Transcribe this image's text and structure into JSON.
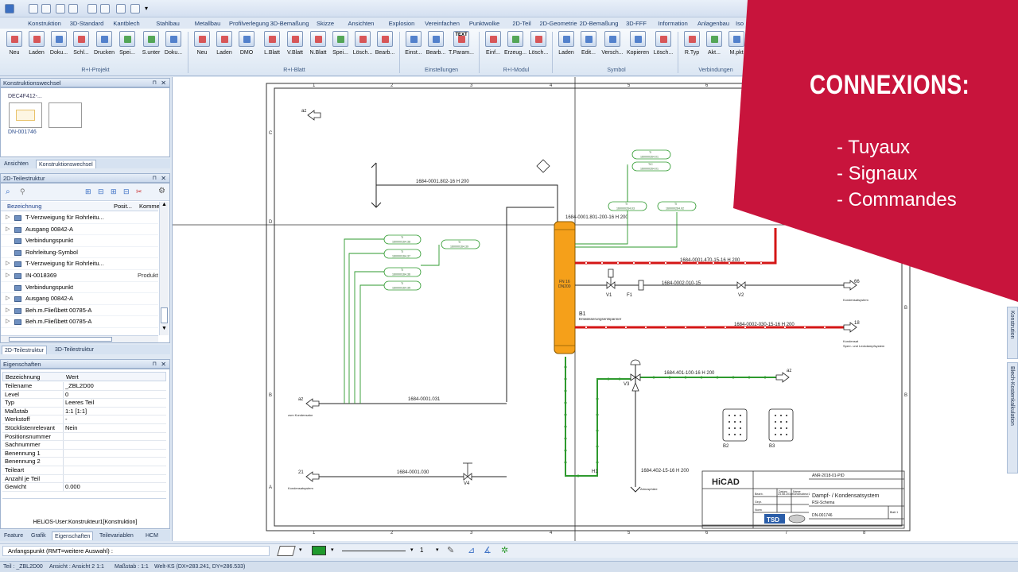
{
  "ribbon": {
    "tabs": [
      "Konstruktion",
      "3D-Standard",
      "Kantblech",
      "Stahlbau",
      "Metallbau",
      "Profilverlegung",
      "3D-Bemaßung",
      "Skizze",
      "Ansichten",
      "Explosion",
      "Vereinfachen",
      "Punktwolke",
      "2D-Teil",
      "2D-Geometrie",
      "2D-Bemaßung",
      "3D-FFF",
      "Information",
      "Anlagenbau",
      "Iso"
    ],
    "buttons": [
      "Neu",
      "Laden",
      "Doku...",
      "Schl...",
      "Drucken",
      "Spei...",
      "S.unter",
      "Doku...",
      "Neu",
      "Laden",
      "DMO",
      "L.Blatt",
      "V.Blatt",
      "N.Blatt",
      "Spei...",
      "Lösch...",
      "Bearb...",
      "Einst...",
      "Bearb...",
      "T.Param...",
      "Einf...",
      "Erzeug...",
      "Lösch...",
      "Laden",
      "Edit...",
      "Versch...",
      "Kopieren",
      "Lösch...",
      "R.Typ",
      "Akt...",
      "M.pkt"
    ],
    "text_icon_label": "TEXT",
    "groups": [
      "R+I-Projekt",
      "R+I-Blatt",
      "Einstellungen",
      "R+I-Modul",
      "Symbol",
      "Verbindungen"
    ]
  },
  "konstruktionswechsel": {
    "title": "Konstruktionswechsel",
    "thumb_label_top": "DEC4F412-...",
    "thumb_label_bottom": "DN-001746",
    "tabs": [
      "Ansichten",
      "Konstruktionswechsel"
    ]
  },
  "teilestruktur": {
    "title": "2D-Teilestruktur",
    "columns": [
      "Bezeichnung",
      "Posit...",
      "Komme..."
    ],
    "rows": [
      {
        "label": "T-Verzweigung für Rohrleitu...",
        "col2": ""
      },
      {
        "label": "Ausgang 00842-A",
        "col2": ""
      },
      {
        "label": "Verbindungspunkt",
        "col2": ""
      },
      {
        "label": "Rohrleitung-Symbol",
        "col2": ""
      },
      {
        "label": "T-Verzweigung für Rohrleitu...",
        "col2": ""
      },
      {
        "label": "IN-0018369",
        "col2": "Produkt"
      },
      {
        "label": "Verbindungspunkt",
        "col2": ""
      },
      {
        "label": "Ausgang 00842-A",
        "col2": ""
      },
      {
        "label": "Beh.m.Fließbett 00785-A",
        "col2": ""
      },
      {
        "label": "Beh.m.Fließbett 00785-A",
        "col2": ""
      }
    ],
    "tabs": [
      "2D-Teilestruktur",
      "3D-Teilestruktur"
    ]
  },
  "eigenschaften": {
    "title": "Eigenschaften",
    "columns": [
      "Bezeichnung",
      "Wert"
    ],
    "rows": [
      {
        "k": "Teilename",
        "v": "_ZBL2D00"
      },
      {
        "k": "Level",
        "v": "0"
      },
      {
        "k": "Typ",
        "v": "Leeres Teil"
      },
      {
        "k": "Maßstab",
        "v": "1:1 [1:1]"
      },
      {
        "k": "Werkstoff",
        "v": "-"
      },
      {
        "k": "Stücklistenrelevant",
        "v": "Nein"
      },
      {
        "k": "Positionsnummer",
        "v": ""
      },
      {
        "k": "Sachnummer",
        "v": ""
      },
      {
        "k": "Benennung 1",
        "v": ""
      },
      {
        "k": "Benennung 2",
        "v": ""
      },
      {
        "k": "Teileart",
        "v": ""
      },
      {
        "k": "Anzahl je Teil",
        "v": ""
      },
      {
        "k": "Gewicht",
        "v": "0.000"
      }
    ],
    "user": "HELiOS-User:Konstrukteur1[Konstruktion]"
  },
  "bottom_tabs": [
    "Feature",
    "Grafik",
    "Eigenschaften",
    "Teilevariablen",
    "HCM"
  ],
  "command": {
    "prompt": "Anfangspunkt (RMT=weitere Auswahl) :",
    "line_number": "1"
  },
  "status": {
    "teil": "Teil : _ZBL2D00",
    "ansicht": "Ansicht : Ansicht 2 1:1",
    "massstab": "Maßstab : 1:1",
    "koord": "Welt-KS (DX=283.241, DY=286.533)"
  },
  "right_tabs": [
    "Konstrution",
    "Blech-Kostenkalkulation"
  ],
  "drawing": {
    "col_numbers": [
      "1",
      "2",
      "3",
      "4",
      "5",
      "6",
      "7",
      "8"
    ],
    "row_letters": [
      "C",
      "D",
      "B",
      "A"
    ],
    "pipes": {
      "p802": "1684-0001.802-16 H 200",
      "p801": "1684-0001.801-200-16 H 200",
      "p470": "1684-0001.470-15-16 H 200",
      "p010": "1684-0002.010-15",
      "p030r": "1684-0002-030-15-16 H 200",
      "p031": "1684-0001.031",
      "p030": "1684-0001.030",
      "p401": "1684.401-100-16 H 200",
      "p402": "1684.402-15-16 H 200"
    },
    "tags": {
      "fn": "FN 16",
      "dn": "DN200",
      "b1": "B1",
      "b1_sub": "Entwässerungsentspanner",
      "v1": "V1",
      "f1": "F1",
      "v2": "V2",
      "v3": "V3",
      "v4": "V4",
      "h1": "H1",
      "b2": "B2",
      "b3": "B3",
      "n66": "66",
      "n66_sub": "Kondensatsystem",
      "n18": "18",
      "n18_sub1": "Kondensat",
      "n18_sub2": "Sperr- und Leckdampfsystem",
      "az": "az",
      "az_left_sub": "zum Kondensator",
      "n21": "21",
      "n21_sub": "Kondensatsystem",
      "atm": "Atmosphäre"
    },
    "instr": {
      "ti": "TI",
      "tic": "TIC",
      "i1": "160000264.01",
      "i2": "160000264.01",
      "i3": "160000264.03",
      "i4": "160000264.02",
      "i5": "160000164.38",
      "i6": "160000164.37",
      "i7": "160000164.36",
      "i8": "160000164.35",
      "i9": "160000164.39"
    },
    "titleblock": {
      "logo": "HiCAD",
      "docnum": "ANR-2018-01-PID",
      "title": "Dampf- / Kondensatsystem",
      "subtitle": "RSI-Schema",
      "tsd": "TSD",
      "dn": "DN-001746",
      "blatt": "Blatt 1",
      "datum_hdr": "Datum",
      "name_hdr": "Name",
      "bearb": "Bearb.",
      "gepr": "Gepr.",
      "norm": "Norm",
      "date_val": "23.08.2016",
      "name_val": "Konstrukteur1"
    }
  },
  "overlay": {
    "title": "CONNEXIONS:",
    "items": [
      "- Tuyaux",
      "-  Signaux",
      "-  Commandes"
    ],
    "color": "#c8143c"
  }
}
